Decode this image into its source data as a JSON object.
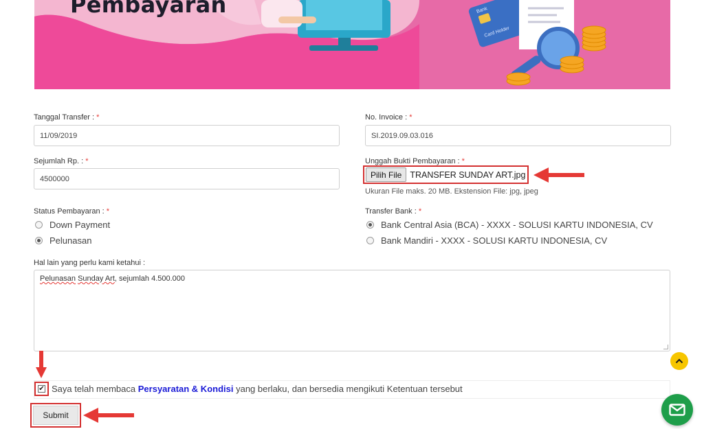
{
  "banner": {
    "title": "Pembayaran"
  },
  "form": {
    "transfer_date": {
      "label": "Tanggal Transfer :",
      "required": "*",
      "value": "11/09/2019"
    },
    "invoice_no": {
      "label": "No. Invoice :",
      "required": "*",
      "value": "SI.2019.09.03.016"
    },
    "amount": {
      "label": "Sejumlah Rp. :",
      "required": "*",
      "value": "4500000"
    },
    "upload": {
      "label": "Unggah Bukti Pembayaran :",
      "required": "*",
      "button_label": "Pilih File",
      "file_name": "TRANSFER SUNDAY ART.jpg",
      "hint": "Ukuran File maks. 20 MB. Ekstension File: jpg, jpeg"
    },
    "payment_status": {
      "label": "Status Pembayaran :",
      "required": "*",
      "options": [
        "Down Payment",
        "Pelunasan"
      ],
      "selected": "Pelunasan"
    },
    "transfer_bank": {
      "label": "Transfer Bank :",
      "required": "*",
      "options": [
        "Bank Central Asia (BCA) - XXXX - SOLUSI KARTU INDONESIA, CV",
        "Bank Mandiri - XXXX - SOLUSI KARTU INDONESIA, CV"
      ],
      "selected": "Bank Central Asia (BCA) - XXXX - SOLUSI KARTU INDONESIA, CV"
    },
    "notes": {
      "label": "Hal lain yang perlu kami ketahui :",
      "value_part1": "Pelunasan",
      "value_part2": "Sunday Art",
      "value_part3": ", sejumlah 4.500.000"
    },
    "agreement": {
      "checked": true,
      "text_before": "Saya telah membaca",
      "link": "Persyaratan & Kondisi",
      "text_after": "yang berlaku, dan bersedia mengikuti Ketentuan tersebut"
    },
    "submit_label": "Submit"
  },
  "colors": {
    "banner_pink": "#e76aa7",
    "highlight_red": "#d32f2f",
    "link_blue": "#1a1ad6",
    "scroll_button": "#f7c600",
    "chat_button": "#1e9e4a"
  },
  "icons": {
    "scroll_top": "chevron-up-icon",
    "chat": "mail-icon"
  }
}
